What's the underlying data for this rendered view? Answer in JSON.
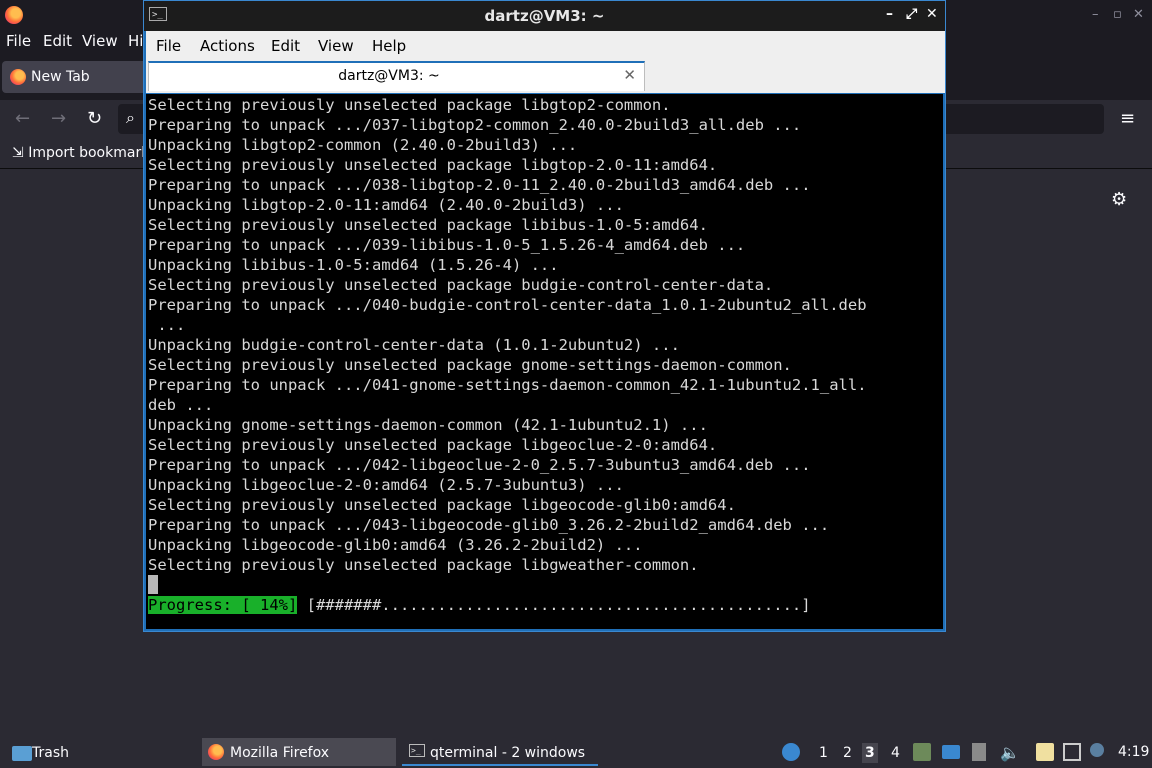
{
  "firefox": {
    "menu": [
      "File",
      "Edit",
      "View",
      "Hi"
    ],
    "tab_label": "New Tab",
    "bookmark_label": "Import bookmarks...",
    "window_controls": [
      "–",
      "▫",
      "✕"
    ]
  },
  "terminal": {
    "title": "dartz@VM3: ~",
    "menu": [
      "File",
      "Actions",
      "Edit",
      "View",
      "Help"
    ],
    "tab_label": "dartz@VM3: ~",
    "lines": [
      "Selecting previously unselected package libgtop2-common.",
      "Preparing to unpack .../037-libgtop2-common_2.40.0-2build3_all.deb ...",
      "Unpacking libgtop2-common (2.40.0-2build3) ...",
      "Selecting previously unselected package libgtop-2.0-11:amd64.",
      "Preparing to unpack .../038-libgtop-2.0-11_2.40.0-2build3_amd64.deb ...",
      "Unpacking libgtop-2.0-11:amd64 (2.40.0-2build3) ...",
      "Selecting previously unselected package libibus-1.0-5:amd64.",
      "Preparing to unpack .../039-libibus-1.0-5_1.5.26-4_amd64.deb ...",
      "Unpacking libibus-1.0-5:amd64 (1.5.26-4) ...",
      "Selecting previously unselected package budgie-control-center-data.",
      "Preparing to unpack .../040-budgie-control-center-data_1.0.1-2ubuntu2_all.deb",
      " ...",
      "Unpacking budgie-control-center-data (1.0.1-2ubuntu2) ...",
      "Selecting previously unselected package gnome-settings-daemon-common.",
      "Preparing to unpack .../041-gnome-settings-daemon-common_42.1-1ubuntu2.1_all.",
      "deb ...",
      "Unpacking gnome-settings-daemon-common (42.1-1ubuntu2.1) ...",
      "Selecting previously unselected package libgeoclue-2-0:amd64.",
      "Preparing to unpack .../042-libgeoclue-2-0_2.5.7-3ubuntu3_amd64.deb ...",
      "Unpacking libgeoclue-2-0:amd64 (2.5.7-3ubuntu3) ...",
      "Selecting previously unselected package libgeocode-glib0:amd64.",
      "Preparing to unpack .../043-libgeocode-glib0_3.26.2-2build2_amd64.deb ...",
      "Unpacking libgeocode-glib0:amd64 (3.26.2-2build2) ...",
      "Selecting previously unselected package libgweather-common."
    ],
    "progress_label": "Progress: [ 14%]",
    "progress_bar": " [#######.............................................]",
    "progress_percent": 14
  },
  "taskbar": {
    "trash_label": "Trash",
    "firefox_task": "Mozilla Firefox",
    "terminal_task": "qterminal - 2 windows",
    "workspaces": [
      "1",
      "2",
      "3",
      "4"
    ],
    "active_workspace": "3",
    "clock": "4:19"
  }
}
